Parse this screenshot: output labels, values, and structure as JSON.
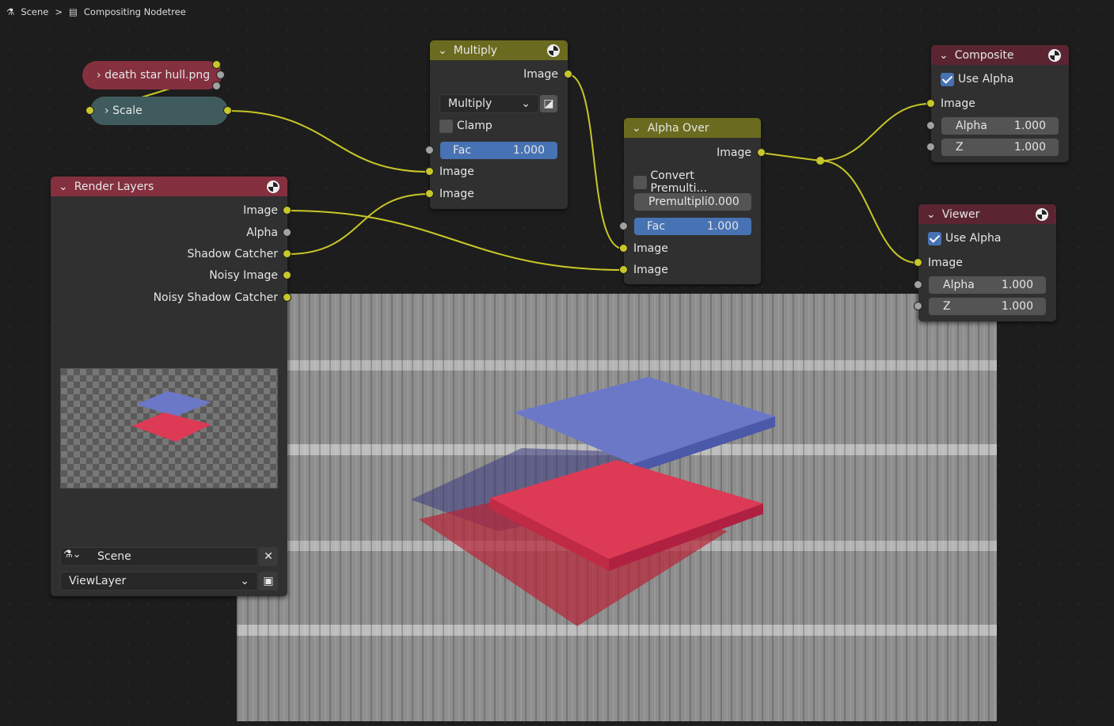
{
  "breadcrumb": {
    "scene": "Scene",
    "tree": "Compositing Nodetree",
    "scene_icon": "scene-icon",
    "tree_icon": "node-tree-icon"
  },
  "collapsed": {
    "image_node": "death star hull.png",
    "scale_node": "Scale"
  },
  "multiply": {
    "title": "Multiply",
    "out": "Image",
    "blend": "Multiply",
    "clamp": "Clamp",
    "fac_label": "Fac",
    "fac": "1.000",
    "in1": "Image",
    "in2": "Image"
  },
  "alpha_over": {
    "title": "Alpha Over",
    "out": "Image",
    "convert": "Convert Premulti...",
    "premul_label": "Premultipli",
    "premul": "0.000",
    "fac_label": "Fac",
    "fac": "1.000",
    "in1": "Image",
    "in2": "Image"
  },
  "render_layers": {
    "title": "Render Layers",
    "outputs": [
      "Image",
      "Alpha",
      "Shadow Catcher",
      "Noisy Image",
      "Noisy Shadow Catcher"
    ],
    "scene": "Scene",
    "layer": "ViewLayer"
  },
  "composite": {
    "title": "Composite",
    "use_alpha": "Use Alpha",
    "image": "Image",
    "alpha_label": "Alpha",
    "alpha": "1.000",
    "z_label": "Z",
    "z": "1.000"
  },
  "viewer": {
    "title": "Viewer",
    "use_alpha": "Use Alpha",
    "image": "Image",
    "alpha_label": "Alpha",
    "alpha": "1.000",
    "z_label": "Z",
    "z": "1.000"
  },
  "colors": {
    "image_socket": "#c7c729",
    "value_socket": "#a1a1a1",
    "field_blue": "#4772b3",
    "wire": "#c7c729"
  }
}
